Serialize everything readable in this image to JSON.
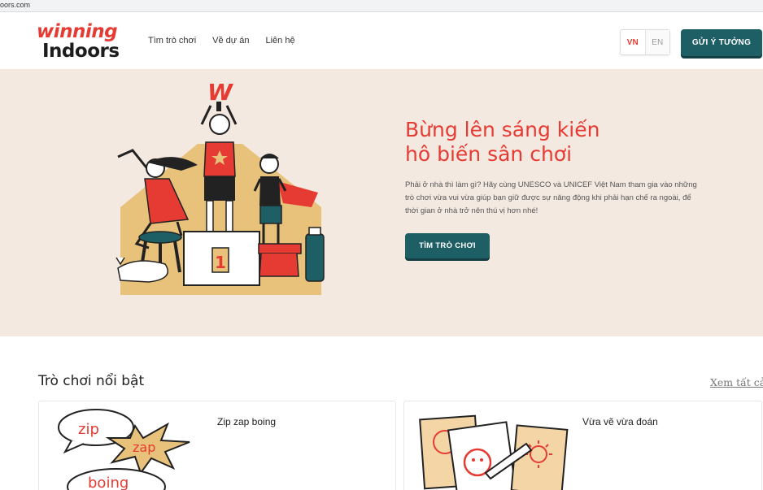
{
  "browser": {
    "url_fragment": "oors.com"
  },
  "header": {
    "logo": {
      "line1": "winning",
      "line2": "Indoors"
    },
    "nav": [
      "Tìm trò chơi",
      "Về dự án",
      "Liên hệ"
    ],
    "lang": {
      "vn": "VN",
      "en": "EN"
    },
    "cta": "GỬI Ý TƯỞNG"
  },
  "hero": {
    "title_line1": "Bừng lên sáng kiến",
    "title_line2": "hô biến sân chơi",
    "description": "Phải ở nhà thì làm gì? Hãy cùng UNESCO và UNICEF Việt Nam tham gia vào những trò chơi vừa vui vừa giúp bạn giữ được sự năng động khi phải hạn chế ra ngoài, để thời gian ở nhà trở nên thú vị hơn nhé!",
    "button": "TÌM TRÒ CHƠI",
    "podium_number": "1",
    "trophy_letter": "W"
  },
  "featured": {
    "title": "Trò chơi nổi bật",
    "see_all": "Xem tất cả",
    "cards": [
      {
        "name": "Zip zap boing",
        "bubbles": [
          "zip",
          "zap",
          "boing"
        ]
      },
      {
        "name": "Vừa vẽ vừa đoán"
      }
    ]
  },
  "colors": {
    "brand_red": "#e63b32",
    "teal": "#1e5f66",
    "hero_bg": "#f4e9e1",
    "house": "#e8c27a"
  }
}
